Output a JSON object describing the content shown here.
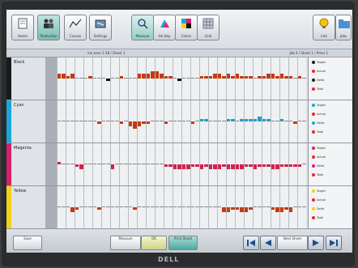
{
  "toolbar": {
    "buttons": [
      {
        "label": "Home",
        "icon": "document-icon"
      },
      {
        "label": "Production",
        "icon": "people-icon"
      },
      {
        "label": "Curves",
        "icon": "graph-icon"
      },
      {
        "label": "Settings",
        "icon": "tools-icon"
      },
      {
        "label": "Measure",
        "icon": "magnifier-icon"
      },
      {
        "label": "Ink Key",
        "icon": "ink-icon"
      },
      {
        "label": "Colors",
        "icon": "color-squares-icon"
      },
      {
        "label": "Grid",
        "icon": "grid-icon"
      }
    ],
    "right_buttons": [
      {
        "label": "Info",
        "icon": "lightbulb-icon"
      },
      {
        "label": "Jobs",
        "icon": "folder-icon"
      }
    ]
  },
  "subbar": {
    "left_text": "ink zone 1-28 / Sheet 1",
    "right_text": "Job 4 / Sheet 1 / Press 1"
  },
  "panels": [
    {
      "name": "Black",
      "stripe": "#1a1a1a",
      "bar_color": "#c43a12",
      "neg_color": "#111111",
      "values": [
        2,
        2,
        1,
        2,
        0,
        0,
        0,
        1,
        0,
        0,
        0,
        -1,
        0,
        0,
        1,
        0,
        0,
        0,
        2,
        2,
        2,
        3,
        3,
        2,
        1,
        1,
        0,
        -1,
        0,
        0,
        0,
        0,
        1,
        1,
        1,
        2,
        2,
        1,
        2,
        1,
        2,
        1,
        1,
        1,
        0,
        1,
        1,
        2,
        2,
        1,
        2,
        1,
        1,
        0,
        1,
        0
      ],
      "side": [
        "Target",
        "Actual",
        "Delta",
        "Total"
      ]
    },
    {
      "name": "Cyan",
      "stripe": "#19a7d9",
      "bar_color": "#2b9bc6",
      "neg_color": "#c43a12",
      "values": [
        0,
        0,
        0,
        0,
        0,
        0,
        0,
        0,
        0,
        -1,
        0,
        0,
        0,
        0,
        -1,
        0,
        -2,
        -3,
        -2,
        -1,
        -1,
        0,
        0,
        0,
        -1,
        0,
        0,
        0,
        0,
        0,
        -1,
        0,
        1,
        1,
        0,
        0,
        0,
        0,
        1,
        1,
        0,
        1,
        1,
        1,
        1,
        2,
        1,
        1,
        0,
        0,
        1,
        0,
        0,
        -1,
        0,
        0
      ],
      "side": [
        "Target",
        "Actual",
        "Delta",
        "Total"
      ]
    },
    {
      "name": "Magenta",
      "stripe": "#d81f6b",
      "bar_color": "#d2224d",
      "neg_color": "#d2224d",
      "values": [
        1,
        0,
        0,
        0,
        -1,
        -2,
        0,
        0,
        0,
        0,
        0,
        0,
        -2,
        0,
        0,
        0,
        0,
        0,
        0,
        0,
        0,
        0,
        0,
        0,
        -1,
        -1,
        -2,
        -2,
        -2,
        -2,
        -1,
        -1,
        -2,
        -1,
        -2,
        -2,
        -2,
        -1,
        -2,
        -2,
        -2,
        -2,
        -1,
        -1,
        -2,
        -1,
        -1,
        -1,
        -2,
        -2,
        -1,
        -1,
        -1,
        -1,
        -1,
        0
      ],
      "side": [
        "Target",
        "Actual",
        "Delta",
        "Total"
      ]
    },
    {
      "name": "Yellow",
      "stripe": "#f3d216",
      "bar_color": "#d89a14",
      "neg_color": "#c43a12",
      "values": [
        0,
        0,
        0,
        -2,
        -1,
        0,
        0,
        0,
        0,
        -1,
        0,
        0,
        0,
        0,
        0,
        0,
        0,
        -1,
        0,
        0,
        0,
        0,
        0,
        0,
        0,
        0,
        0,
        0,
        0,
        0,
        0,
        0,
        0,
        0,
        0,
        0,
        0,
        -2,
        -2,
        -1,
        -1,
        -2,
        -2,
        -1,
        0,
        0,
        0,
        0,
        -1,
        -2,
        -2,
        -1,
        -2,
        0,
        0,
        0
      ],
      "side": [
        "Target",
        "Actual",
        "Delta",
        "Total"
      ]
    }
  ],
  "bottom": {
    "left_label": "Save",
    "buttons": [
      "Measure",
      "OK",
      "Print Sheet"
    ],
    "nav_label": "Next Sheet"
  },
  "monitor_brand": "DELL"
}
